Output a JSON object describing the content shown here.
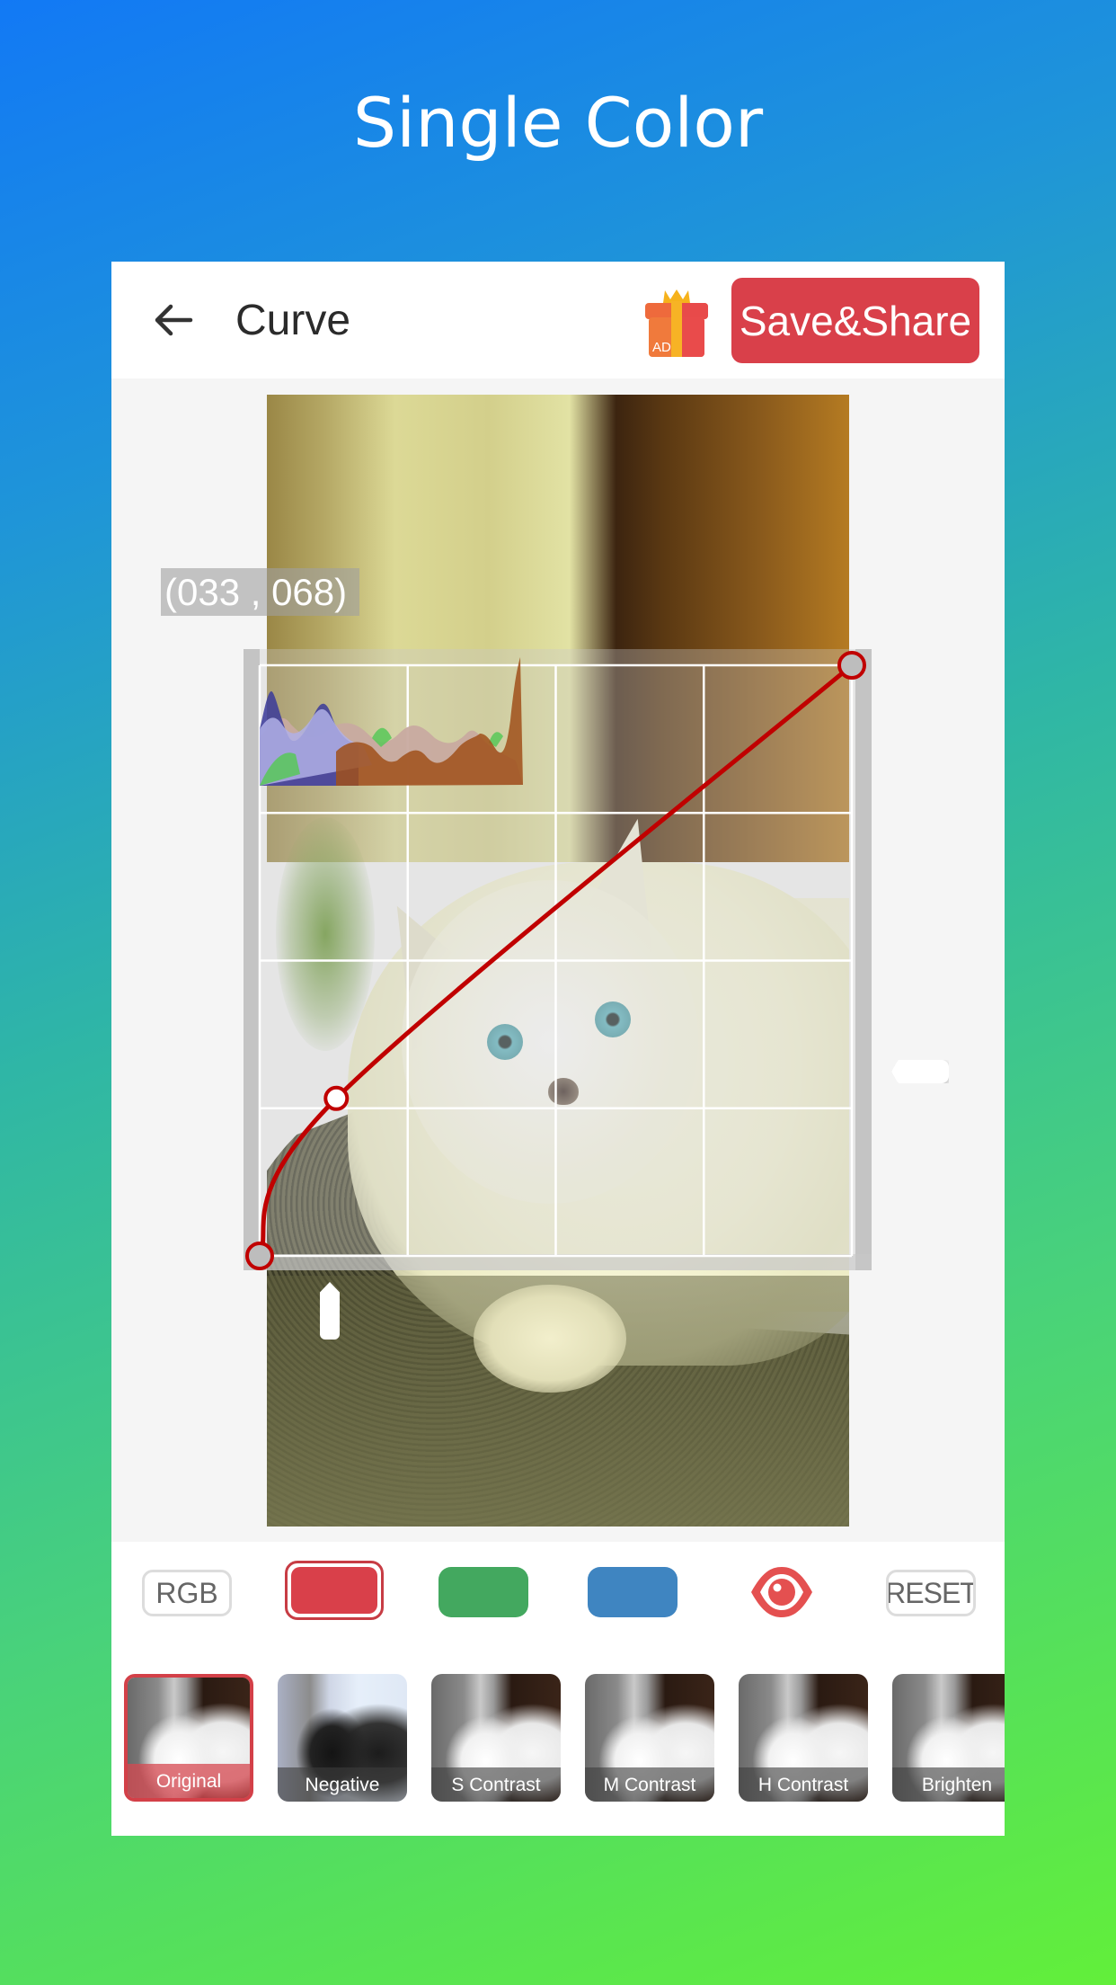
{
  "promo": {
    "title": "Single Color"
  },
  "header": {
    "back_icon": "arrow-left-icon",
    "title": "Curve",
    "gift_icon": "gift-ad-icon",
    "gift_badge": "AD",
    "save_label": "Save&Share"
  },
  "editor": {
    "coordinate_readout": "(033 , 068)",
    "curve": {
      "channel": "red",
      "points": [
        {
          "input": 0,
          "output": 0
        },
        {
          "input": 33,
          "output": 68
        },
        {
          "input": 255,
          "output": 255
        }
      ],
      "range": [
        0,
        255
      ],
      "grid_divisions": 4
    }
  },
  "controls": {
    "rgb_label": "RGB",
    "channels": [
      {
        "name": "red",
        "color": "#d9404a",
        "selected": true
      },
      {
        "name": "green",
        "color": "#43a85f",
        "selected": false
      },
      {
        "name": "blue",
        "color": "#3f85c1",
        "selected": false
      }
    ],
    "preview_icon": "eye-icon",
    "reset_label": "RESET"
  },
  "presets": [
    {
      "label": "Original",
      "selected": true
    },
    {
      "label": "Negative",
      "selected": false
    },
    {
      "label": "S Contrast",
      "selected": false
    },
    {
      "label": "M Contrast",
      "selected": false
    },
    {
      "label": "H Contrast",
      "selected": false
    },
    {
      "label": "Brighten",
      "selected": false
    }
  ],
  "colors": {
    "accent": "#d9404a",
    "curve_line": "#c00000"
  }
}
